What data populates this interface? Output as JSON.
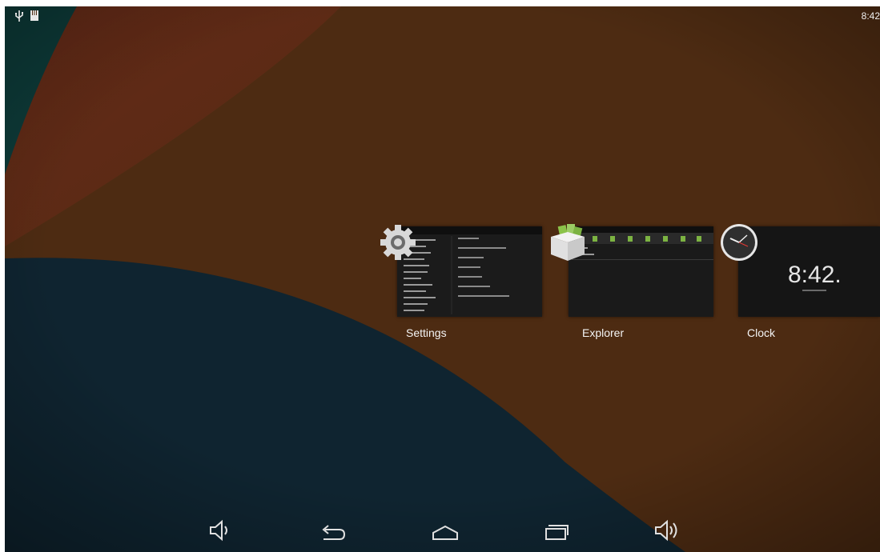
{
  "status_bar": {
    "time": "8:42",
    "icons": [
      "usb-icon",
      "sd-card-icon"
    ]
  },
  "recent_apps": [
    {
      "label": "Settings",
      "icon": "settings-gear-icon"
    },
    {
      "label": "Explorer",
      "icon": "explorer-box-icon"
    },
    {
      "label": "Clock",
      "icon": "analog-clock-icon"
    }
  ],
  "clock_thumbnail": {
    "time": "8:42."
  },
  "nav_bar": {
    "buttons": [
      "volume-down-icon",
      "back-icon",
      "home-icon",
      "recents-icon",
      "volume-up-icon"
    ]
  },
  "colors": {
    "wallpaper_red": "#7a2a1c",
    "wallpaper_brown": "#4d2b12",
    "wallpaper_navy": "#0f2430",
    "wallpaper_teal": "#0d3a38"
  }
}
